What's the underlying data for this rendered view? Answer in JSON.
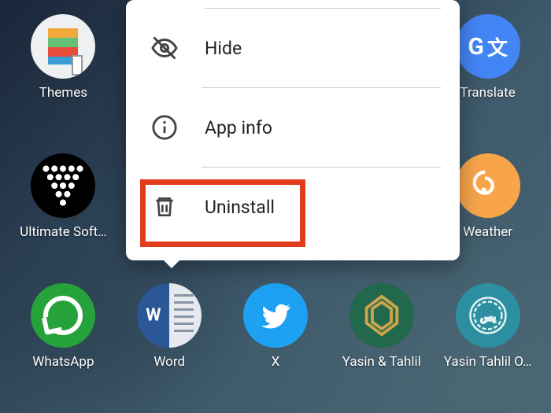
{
  "menu": {
    "items": [
      {
        "label": "Hide"
      },
      {
        "label": "App info"
      },
      {
        "label": "Uninstall"
      }
    ]
  },
  "highlight_color": "#e23c1e",
  "apps": {
    "row1": [
      {
        "label": "Themes"
      },
      {
        "label": ""
      },
      {
        "label": ""
      },
      {
        "label": ""
      },
      {
        "label": "Translate"
      }
    ],
    "row2": [
      {
        "label": "Ultimate Soft…"
      },
      {
        "label": ""
      },
      {
        "label": ""
      },
      {
        "label": ""
      },
      {
        "label": "Weather"
      }
    ],
    "row3": [
      {
        "label": "WhatsApp"
      },
      {
        "label": "Word"
      },
      {
        "label": "X"
      },
      {
        "label": "Yasin & Tahlil"
      },
      {
        "label": "Yasin Tahlil O…"
      }
    ]
  }
}
